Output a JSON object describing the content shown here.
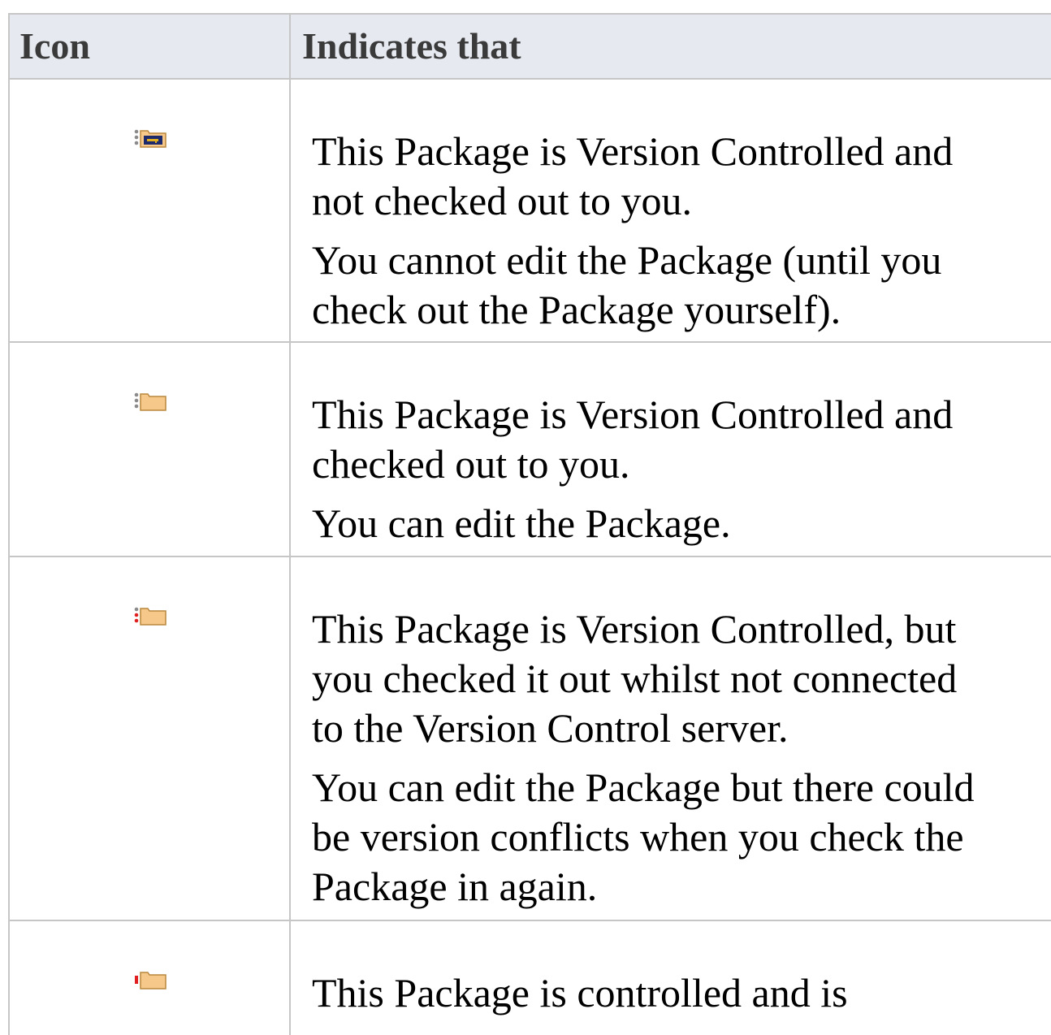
{
  "table": {
    "headers": {
      "icon": "Icon",
      "description": "Indicates that"
    },
    "rows": [
      {
        "icon": "package-version-controlled-locked-icon",
        "paragraphs": [
          "This Package is Version Controlled and\nnot checked out to you.",
          "You cannot edit the Package (until you\ncheck out the Package yourself)."
        ]
      },
      {
        "icon": "package-checked-out-icon",
        "paragraphs": [
          "This Package is Version Controlled and\nchecked out to you.",
          "You can edit the Package."
        ]
      },
      {
        "icon": "package-checked-out-offline-icon",
        "paragraphs": [
          "This Package is Version Controlled, but\nyou checked it out whilst not connected\nto the Version Control server.",
          "You can edit the Package but there could\nbe version conflicts when you check the\nPackage in again."
        ]
      },
      {
        "icon": "package-controlled-icon",
        "paragraphs": [
          "This Package is controlled and is"
        ]
      }
    ]
  },
  "colors": {
    "header_background": "#e6e9f0",
    "grid_line": "#c6c6c6",
    "folder_fill": "#f6c88a",
    "folder_stroke": "#b9873e",
    "lock_navy": "#1c2a6b",
    "gold": "#e0b020",
    "red_mark": "#e02020"
  }
}
